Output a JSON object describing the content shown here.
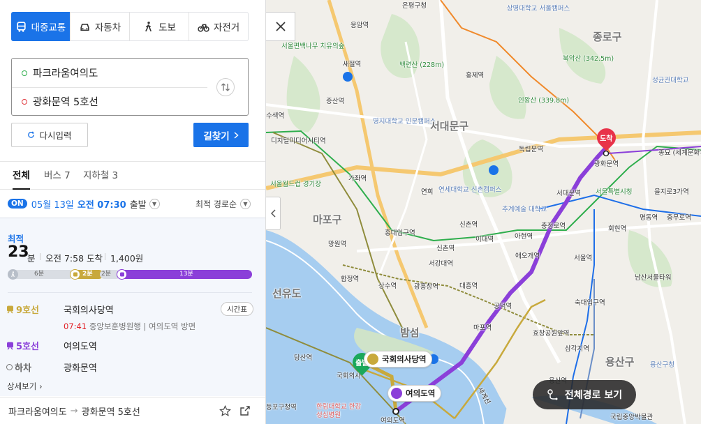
{
  "mode_tabs": [
    {
      "label": "대중교통",
      "icon": "bus-icon",
      "active": true
    },
    {
      "label": "자동차",
      "icon": "car-icon",
      "active": false
    },
    {
      "label": "도보",
      "icon": "walk-icon",
      "active": false
    },
    {
      "label": "자전거",
      "icon": "bicycle-icon",
      "active": false
    }
  ],
  "origin": "파크라움여의도",
  "destination": "광화문역 5호선",
  "reset_label": "다시입력",
  "search_label": "길찾기",
  "result_tabs": [
    {
      "label": "전체",
      "active": true
    },
    {
      "label": "버스 7",
      "active": false
    },
    {
      "label": "지하철 3",
      "active": false
    }
  ],
  "departure": {
    "badge": "ON",
    "date": "05월 13일",
    "time": "오전 07:30",
    "suffix": "출발",
    "sort": "최적 경로순"
  },
  "route": {
    "best_label": "최적",
    "duration_value": "23",
    "duration_unit": "분",
    "arrival": "오전 7:58 도착",
    "fare": "1,400원",
    "segments": [
      {
        "kind": "walk",
        "label": "6분",
        "color": "#d9dde3"
      },
      {
        "kind": "bus",
        "label": "2분",
        "color": "#c8a93c"
      },
      {
        "kind": "transfer",
        "label": "2분",
        "color": "#d9dde3"
      },
      {
        "kind": "subway",
        "label": "13분",
        "color": "#8b3fd9"
      }
    ],
    "legs": [
      {
        "line": "9호선",
        "name": "국회의사당역",
        "color": "#c8a93c"
      },
      {
        "line": "5호선",
        "name": "여의도역",
        "color": "#8b3fd9"
      },
      {
        "line": "하차",
        "name": "광화문역",
        "color": "#666666"
      }
    ],
    "timetable_label": "시간표",
    "next_time": "07:41",
    "next_info": "중앙보훈병원행 | 여의도역 방면",
    "detail_label": "상세보기"
  },
  "footer": {
    "from": "파크라움여의도",
    "to": "광화문역 5호선"
  },
  "map": {
    "labels": [
      {
        "text": "은평구청",
        "cls": ""
      },
      {
        "text": "상명대학교 서울캠퍼스",
        "cls": "blue"
      },
      {
        "text": "종로구",
        "cls": "big"
      },
      {
        "text": "응암역",
        "cls": ""
      },
      {
        "text": "서울편백나무 치유의숲",
        "cls": "green"
      },
      {
        "text": "백련산 (228m)",
        "cls": "green"
      },
      {
        "text": "북악산 (342.5m)",
        "cls": "green"
      },
      {
        "text": "성균관대학교",
        "cls": "blue"
      },
      {
        "text": "새절역",
        "cls": ""
      },
      {
        "text": "홍제역",
        "cls": ""
      },
      {
        "text": "인왕산 (339.8m)",
        "cls": "green"
      },
      {
        "text": "증산역",
        "cls": ""
      },
      {
        "text": "수색역",
        "cls": ""
      },
      {
        "text": "명지대학교 인문캠퍼스",
        "cls": "blue"
      },
      {
        "text": "서대문구",
        "cls": "big"
      },
      {
        "text": "디지털미디어시티역",
        "cls": ""
      },
      {
        "text": "독립문역",
        "cls": ""
      },
      {
        "text": "광화문역",
        "cls": ""
      },
      {
        "text": "종묘 (세계문화유산)",
        "cls": ""
      },
      {
        "text": "가좌역",
        "cls": ""
      },
      {
        "text": "서울월드컵 경기장",
        "cls": "green"
      },
      {
        "text": "연세대학교 신촌캠퍼스",
        "cls": "blue"
      },
      {
        "text": "연희",
        "cls": ""
      },
      {
        "text": "서대문역",
        "cls": ""
      },
      {
        "text": "서울특별시청",
        "cls": "green"
      },
      {
        "text": "을지로3가역",
        "cls": ""
      },
      {
        "text": "마포구",
        "cls": "big"
      },
      {
        "text": "추계예술 대학교",
        "cls": "blue"
      },
      {
        "text": "명동역",
        "cls": ""
      },
      {
        "text": "충무로역",
        "cls": ""
      },
      {
        "text": "충정로역",
        "cls": ""
      },
      {
        "text": "신촌역",
        "cls": ""
      },
      {
        "text": "홍대입구역",
        "cls": ""
      },
      {
        "text": "아현역",
        "cls": ""
      },
      {
        "text": "회현역",
        "cls": ""
      },
      {
        "text": "망원역",
        "cls": ""
      },
      {
        "text": "이대역",
        "cls": ""
      },
      {
        "text": "신촌역",
        "cls": ""
      },
      {
        "text": "애오개역",
        "cls": ""
      },
      {
        "text": "서울역",
        "cls": ""
      },
      {
        "text": "서강대역",
        "cls": ""
      },
      {
        "text": "남산서울타워",
        "cls": ""
      },
      {
        "text": "합정역",
        "cls": ""
      },
      {
        "text": "상수역",
        "cls": ""
      },
      {
        "text": "광흥창역",
        "cls": ""
      },
      {
        "text": "대흥역",
        "cls": ""
      },
      {
        "text": "공덕역",
        "cls": ""
      },
      {
        "text": "숙대입구역",
        "cls": ""
      },
      {
        "text": "선유도",
        "cls": "big"
      },
      {
        "text": "밤섬",
        "cls": "big"
      },
      {
        "text": "마포역",
        "cls": ""
      },
      {
        "text": "효창공원앞역",
        "cls": ""
      },
      {
        "text": "삼각지역",
        "cls": ""
      },
      {
        "text": "당산역",
        "cls": ""
      },
      {
        "text": "용산구",
        "cls": "big"
      },
      {
        "text": "용산구청",
        "cls": "blue"
      },
      {
        "text": "국회의사",
        "cls": ""
      },
      {
        "text": "용산역",
        "cls": ""
      },
      {
        "text": "등포구청역",
        "cls": ""
      },
      {
        "text": "한림대학교 한강성심병원",
        "cls": ""
      },
      {
        "text": "여의도역",
        "cls": ""
      },
      {
        "text": "국립중앙박물관",
        "cls": ""
      },
      {
        "text": "세계선",
        "cls": ""
      }
    ],
    "start_pin": "출발",
    "end_pin": "도착",
    "start_station": "국회의사당역",
    "transfer_station": "여의도역",
    "full_route_label": "전체경로 보기"
  }
}
